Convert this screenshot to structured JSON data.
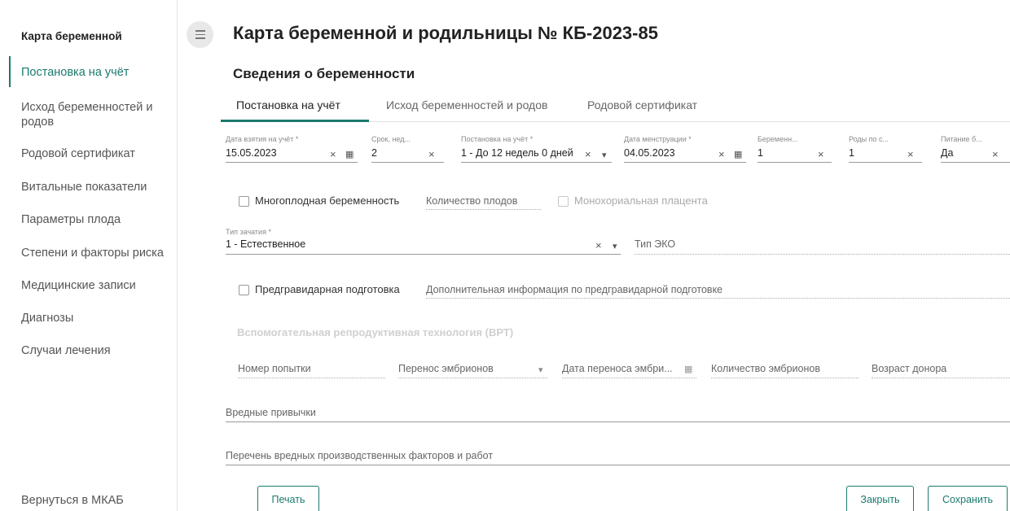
{
  "sidebar": {
    "title": "Карта беременной",
    "items": [
      {
        "label": "Постановка на учёт"
      },
      {
        "label": "Исход беременностей и родов"
      },
      {
        "label": "Родовой сертификат"
      },
      {
        "label": "Витальные показатели"
      },
      {
        "label": "Параметры плода"
      },
      {
        "label": "Степени и факторы риска"
      },
      {
        "label": "Медицинские записи"
      },
      {
        "label": "Диагнозы"
      },
      {
        "label": "Случаи лечения"
      }
    ],
    "back_label": "Вернуться в МКАБ"
  },
  "header": {
    "title": "Карта беременной и родильницы № КБ-2023-85",
    "section": "Сведения о беременности"
  },
  "tabs": [
    {
      "label": "Постановка на учёт"
    },
    {
      "label": "Исход беременностей и родов"
    },
    {
      "label": "Родовой сертификат"
    }
  ],
  "fields": {
    "reg_date": {
      "label": "Дата взятия на учёт *",
      "value": "15.05.2023"
    },
    "term_weeks": {
      "label": "Срок, нед...",
      "value": "2"
    },
    "registration": {
      "label": "Постановка на учёт *",
      "value": "1 - До 12 недель 0 дней"
    },
    "menstruation_date": {
      "label": "Дата менструации *",
      "value": "04.05.2023"
    },
    "pregnancy_count": {
      "label": "Беременн...",
      "value": "1"
    },
    "births_count": {
      "label": "Роды по с...",
      "value": "1"
    },
    "nutrition": {
      "label": "Питание б...",
      "value": "Да"
    },
    "multiple_pregnancy": {
      "label": "Многоплодная беременность"
    },
    "fetus_count": {
      "placeholder": "Количество плодов"
    },
    "monochorionic": {
      "label": "Монохориальная плацента"
    },
    "conception_type": {
      "label": "Тип зачатия *",
      "value": "1 - Естественное"
    },
    "eco_type": {
      "placeholder": "Тип ЭКО"
    },
    "pregravid_prep": {
      "label": "Предгравидарная подготовка"
    },
    "pregravid_info": {
      "placeholder": "Дополнительная информация по предгравидарной подготовке"
    }
  },
  "vrt": {
    "title": "Вспомогательная репродуктивная технология (ВРТ)",
    "attempt_number": "Номер попытки",
    "embryo_transfer": "Перенос эмбрионов",
    "transfer_date": "Дата переноса эмбри...",
    "embryo_count": "Количество эмбрионов",
    "donor_age": "Возраст донора"
  },
  "habits": {
    "placeholder": "Вредные привычки"
  },
  "hazards": {
    "placeholder": "Перечень вредных производственных факторов и работ"
  },
  "buttons": {
    "print": "Печать",
    "close": "Закрыть",
    "save": "Сохранить"
  },
  "icons": {
    "clear": "×",
    "dropdown": "▾",
    "calendar": "calendar-icon",
    "menu": "hamburger-icon"
  },
  "colors": {
    "accent": "#1a7a6d"
  }
}
